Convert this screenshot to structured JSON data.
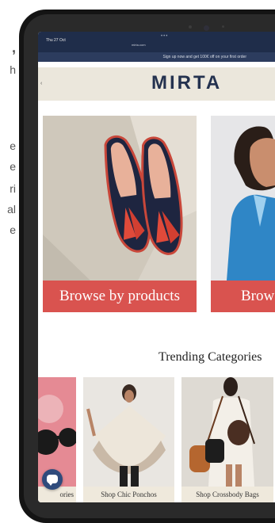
{
  "background_text": {
    "lines": [
      ",",
      "h",
      "e",
      "e",
      "ri",
      "al",
      "e"
    ]
  },
  "status_bar": {
    "time": "Thu 27 Oct",
    "dots": "•••",
    "url": "mirta.com"
  },
  "promo_bar": {
    "text": "Sign up now and get 100€ off on your first order"
  },
  "header": {
    "logo": "MIRTA",
    "menu_glyph": "‹"
  },
  "hero_cards": [
    {
      "label": "Browse by products"
    },
    {
      "label": "Brows"
    }
  ],
  "trending": {
    "title": "Trending Categories",
    "tiles": [
      {
        "caption": "ories"
      },
      {
        "caption": "Shop Chic Ponchos"
      },
      {
        "caption": "Shop Crossbody Bags"
      }
    ]
  },
  "colors": {
    "accent_red": "#d9534f",
    "navy": "#24324f",
    "header_bg": "#ebe7dc"
  },
  "icons": {
    "chat": "chat-bubble-icon"
  }
}
